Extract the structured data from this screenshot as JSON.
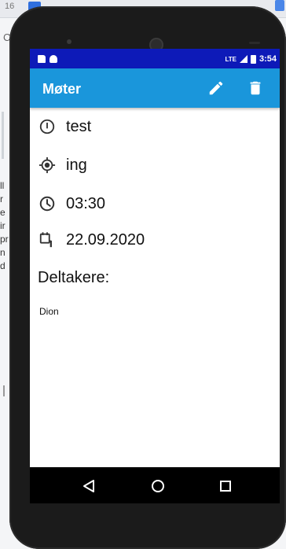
{
  "background": {
    "tab_number": "16",
    "left_letter": "C",
    "left_fragments": [
      "ll",
      "r",
      "e",
      "ir",
      "pr",
      "",
      "n",
      "d"
    ]
  },
  "status_bar": {
    "network_label": "LTE",
    "time": "3:54",
    "color": "#0d1ab8"
  },
  "app_bar": {
    "title": "Møter",
    "color": "#1a96db",
    "actions": [
      {
        "name": "edit",
        "icon": "pencil-icon"
      },
      {
        "name": "delete",
        "icon": "trash-icon"
      }
    ]
  },
  "meeting": {
    "title": "test",
    "location": "ing",
    "time": "03:30",
    "date": "22.09.2020",
    "participants_heading": "Deltakere:",
    "participants": [
      "Dion"
    ]
  },
  "nav_bar": {
    "buttons": [
      "back",
      "home",
      "recents"
    ]
  }
}
